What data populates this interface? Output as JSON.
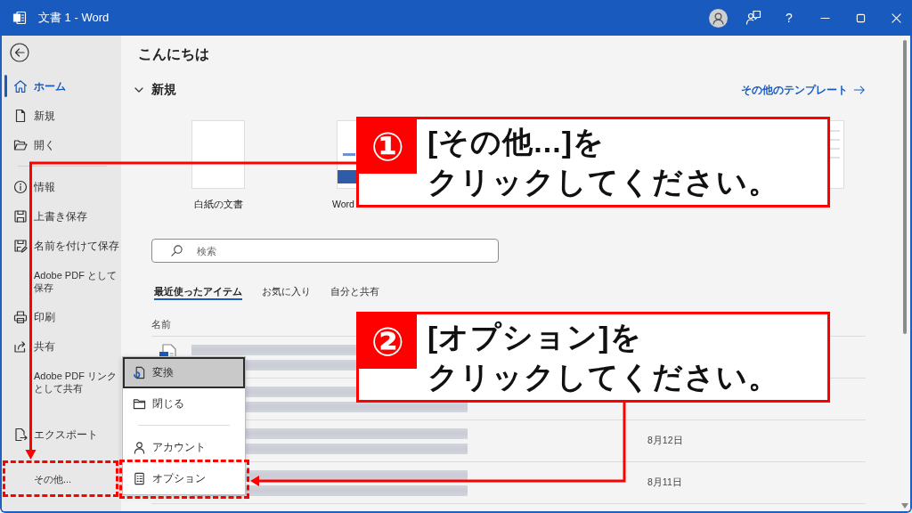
{
  "window": {
    "title": "文書 1 - Word",
    "help_label": "?"
  },
  "sidebar": {
    "items": [
      {
        "kind": "item",
        "label": "ホーム",
        "selected": true
      },
      {
        "kind": "item",
        "label": "新規",
        "selected": false
      },
      {
        "kind": "item",
        "label": "開く",
        "selected": false
      },
      {
        "kind": "divider"
      },
      {
        "kind": "item",
        "label": "情報",
        "selected": false
      },
      {
        "kind": "item",
        "label": "上書き保存",
        "selected": false
      },
      {
        "kind": "item",
        "label": "名前を付けて保存",
        "selected": false
      },
      {
        "kind": "plain",
        "label": "Adobe PDF として保存",
        "selected": false
      },
      {
        "kind": "item",
        "label": "印刷",
        "selected": false
      },
      {
        "kind": "item",
        "label": "共有",
        "selected": false
      },
      {
        "kind": "plain",
        "label": "Adobe PDF リンクとして共有",
        "selected": false
      }
    ],
    "bottom_items": [
      {
        "kind": "item",
        "label": "エクスポート",
        "selected": false
      },
      {
        "kind": "plain",
        "label": "その他...",
        "selected": false
      }
    ]
  },
  "main": {
    "greeting": "こんにちは",
    "new_section": {
      "title": "新規",
      "expanded": true,
      "more_link": "その他のテンプレート",
      "templates": [
        {
          "kind": "blank",
          "label": "白紙の文書"
        },
        {
          "kind": "welcome",
          "label": "Word"
        },
        {
          "kind": "resume"
        }
      ]
    },
    "search": {
      "placeholder": "検索"
    },
    "tabs": [
      {
        "label": "最近使ったアイテム",
        "selected": true
      },
      {
        "label": "お気に入り",
        "selected": false
      },
      {
        "label": "自分と共有",
        "selected": false
      }
    ],
    "file_list": {
      "columns": [
        "名前"
      ],
      "rows": [
        {
          "kind": "document",
          "redacted": true
        },
        {
          "kind": "hidden",
          "redacted": true
        },
        {
          "kind": "hidden",
          "redacted": true,
          "date": "8月12日"
        },
        {
          "kind": "hidden",
          "redacted": true,
          "date": "8月11日"
        }
      ]
    }
  },
  "popup_menu": {
    "items": [
      {
        "kind": "item",
        "label": "変換",
        "highlighted": true
      },
      {
        "kind": "item",
        "label": "閉じる",
        "highlighted": false
      },
      {
        "kind": "divider"
      },
      {
        "kind": "item",
        "label": "アカウント",
        "highlighted": false
      },
      {
        "kind": "item",
        "label": "オプション",
        "highlighted": false
      }
    ]
  },
  "annotations": [
    {
      "number": "①",
      "lines": [
        "[その他...]を",
        "クリックしてください。"
      ]
    },
    {
      "number": "②",
      "lines": [
        "[オプション]を",
        "クリックしてください。"
      ]
    }
  ]
}
